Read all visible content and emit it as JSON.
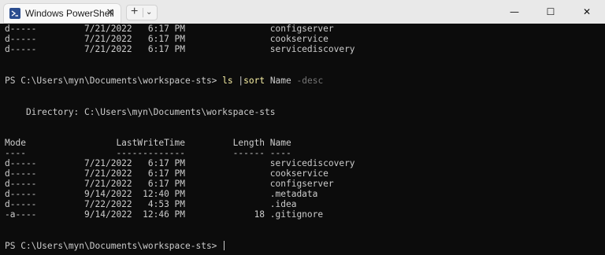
{
  "window": {
    "tab_title": "Windows PowerShell",
    "close_tab_glyph": "✕",
    "new_tab_glyph": "+",
    "dropdown_glyph": "⌄",
    "minimize_glyph": "—",
    "maximize_glyph": "☐",
    "close_glyph": "✕"
  },
  "terminal": {
    "top_rows": [
      "d-----         7/21/2022   6:17 PM                configserver",
      "d-----         7/21/2022   6:17 PM                cookservice",
      "d-----         7/21/2022   6:17 PM                servicediscovery"
    ],
    "prompt1": {
      "prompt": "PS C:\\Users\\myn\\Documents\\workspace-sts> ",
      "cmd1": "ls",
      "pipe": " |",
      "cmd2": "sort",
      "arg": " Name ",
      "flag": "-desc"
    },
    "directory_line": "    Directory: C:\\Users\\myn\\Documents\\workspace-sts",
    "header": "Mode                 LastWriteTime         Length Name",
    "underline": "----                 -------------         ------ ----",
    "rows": [
      "d-----         7/21/2022   6:17 PM                servicediscovery",
      "d-----         7/21/2022   6:17 PM                cookservice",
      "d-----         7/21/2022   6:17 PM                configserver",
      "d-----         9/14/2022  12:40 PM                .metadata",
      "d-----         7/22/2022   4:53 PM                .idea",
      "-a----         9/14/2022  12:46 PM             18 .gitignore"
    ],
    "prompt2": "PS C:\\Users\\myn\\Documents\\workspace-sts> "
  },
  "colors": {
    "background": "#0c0c0c",
    "foreground": "#cccccc",
    "command": "#f9f1a5",
    "hint": "#767676",
    "titlebar": "#e9e9e9"
  }
}
